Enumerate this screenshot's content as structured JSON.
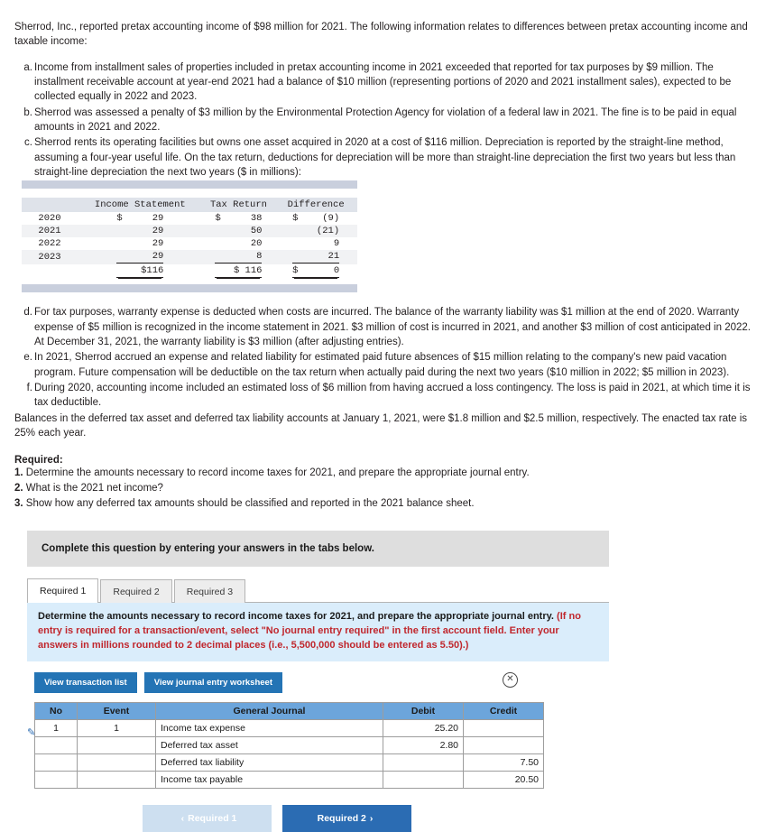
{
  "problem": {
    "intro": "Sherrod, Inc., reported pretax accounting income of $98 million for 2021. The following information relates to differences between pretax accounting income and taxable income:",
    "facts": [
      {
        "marker": "a.",
        "text": "Income from installment sales of properties included in pretax accounting income in 2021 exceeded that reported for tax purposes by $9 million. The installment receivable account at year-end 2021 had a balance of $10 million (representing portions of 2020 and 2021 installment sales), expected to be collected equally in 2022 and 2023."
      },
      {
        "marker": "b.",
        "text": "Sherrod was assessed a penalty of $3 million by the Environmental Protection Agency for violation of a federal law in 2021. The fine is to be paid in equal amounts in 2021 and 2022."
      },
      {
        "marker": "c.",
        "text": "Sherrod rents its operating facilities but owns one asset acquired in 2020 at a cost of $116 million. Depreciation is reported by the straight-line method, assuming a four-year useful life. On the tax return, deductions for depreciation will be more than straight-line depreciation the first two years but less than straight-line depreciation the next two years ($ in millions):"
      }
    ],
    "facts_after": [
      {
        "marker": "d.",
        "text": "For tax purposes, warranty expense is deducted when costs are incurred. The balance of the warranty liability was $1 million at the end of 2020. Warranty expense of $5 million is recognized in the income statement in 2021. $3 million of cost is incurred in 2021, and another $3 million of cost anticipated in 2022. At December 31, 2021, the warranty liability is $3 million (after adjusting entries)."
      },
      {
        "marker": "e.",
        "text": "In 2021, Sherrod accrued an expense and related liability for estimated paid future absences of $15 million relating to the company's new paid vacation program. Future compensation will be deductible on the tax return when actually paid during the next two years ($10 million in 2022; $5 million in 2023)."
      },
      {
        "marker": "f.",
        "text": "During 2020, accounting income included an estimated loss of $6 million from having accrued a loss contingency. The loss is paid in 2021, at which time it is tax deductible."
      }
    ],
    "balances": "Balances in the deferred tax asset and deferred tax liability accounts at January 1, 2021, were $1.8 million and $2.5 million, respectively. The enacted tax rate is 25% each year.",
    "required_title": "Required:",
    "required_items": [
      {
        "num": "1.",
        "text": " Determine the amounts necessary to record income taxes for 2021, and prepare the appropriate journal entry."
      },
      {
        "num": "2.",
        "text": " What is the 2021 net income?"
      },
      {
        "num": "3.",
        "text": " Show how any deferred tax amounts should be classified and reported in the 2021 balance sheet."
      }
    ]
  },
  "depreciation_table": {
    "headers": [
      "",
      "Income Statement",
      "Tax Return",
      "Difference"
    ],
    "rows": [
      {
        "year": "2020",
        "income_statement": "29",
        "income_statement_cur": "$",
        "tax_return": "38",
        "tax_return_cur": "$",
        "difference": "(9)",
        "difference_cur": "$"
      },
      {
        "year": "2021",
        "income_statement": "29",
        "income_statement_cur": "",
        "tax_return": "50",
        "tax_return_cur": "",
        "difference": "(21)",
        "difference_cur": ""
      },
      {
        "year": "2022",
        "income_statement": "29",
        "income_statement_cur": "",
        "tax_return": "20",
        "tax_return_cur": "",
        "difference": "9",
        "difference_cur": ""
      },
      {
        "year": "2023",
        "income_statement": "29",
        "income_statement_cur": "",
        "tax_return": "8",
        "tax_return_cur": "",
        "difference": "21",
        "difference_cur": ""
      }
    ],
    "total": {
      "year": "",
      "income_statement": "$116",
      "tax_return": "$ 116",
      "difference": "0",
      "difference_cur": "$"
    }
  },
  "workspace": {
    "banner": "Complete this question by entering your answers in the tabs below.",
    "tabs": [
      {
        "label": "Required 1",
        "active": true
      },
      {
        "label": "Required 2",
        "active": false
      },
      {
        "label": "Required 3",
        "active": false
      }
    ],
    "instruction_black": "Determine the amounts necessary to record income taxes for 2021, and prepare the appropriate journal entry. ",
    "instruction_red": "(If no entry is required for a transaction/event, select \"No journal entry required\" in the first account field. Enter your answers in millions rounded to 2 decimal places (i.e., 5,500,000 should be entered as 5.50).)",
    "view_transaction_list": "View transaction list",
    "view_journal_worksheet": "View journal entry worksheet",
    "close_icon": "close-icon",
    "edit_icon": "pencil-icon"
  },
  "journal": {
    "headers": [
      "No",
      "Event",
      "General Journal",
      "Debit",
      "Credit"
    ],
    "rows": [
      {
        "no": "1",
        "event": "1",
        "account": "Income tax expense",
        "indent": false,
        "debit": "25.20",
        "credit": ""
      },
      {
        "no": "",
        "event": "",
        "account": "Deferred tax asset",
        "indent": false,
        "debit": "2.80",
        "credit": ""
      },
      {
        "no": "",
        "event": "",
        "account": "Deferred tax liability",
        "indent": true,
        "debit": "",
        "credit": "7.50"
      },
      {
        "no": "",
        "event": "",
        "account": "Income tax payable",
        "indent": true,
        "debit": "",
        "credit": "20.50"
      }
    ]
  },
  "footer_nav": {
    "prev_label": "Required 1",
    "next_label": "Required 2",
    "prev_chevron": "‹",
    "next_chevron": "›"
  },
  "colors": {
    "accent_blue": "#2b6cb3",
    "header_blue": "#6ca5db",
    "instruction_bg": "#daedfb",
    "red_text": "#c0272d",
    "band": "#c9cfdd"
  }
}
